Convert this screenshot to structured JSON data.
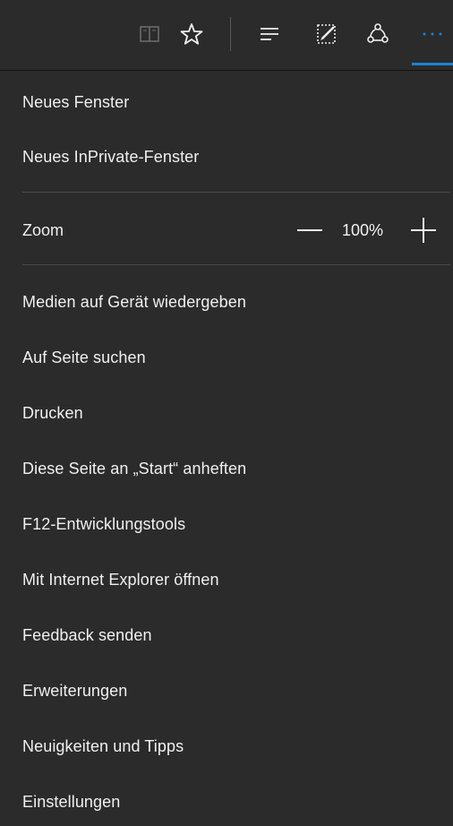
{
  "toolbar": {
    "buttons": [
      {
        "name": "reading-view-icon"
      },
      {
        "name": "favorites-star-icon"
      },
      {
        "name": "hub-icon"
      },
      {
        "name": "web-note-icon"
      },
      {
        "name": "share-icon"
      },
      {
        "name": "more-actions-icon"
      }
    ],
    "accent_color": "#1883d7"
  },
  "menu": {
    "new_window": "Neues Fenster",
    "new_inprivate_window": "Neues InPrivate-Fenster",
    "zoom": {
      "label": "Zoom",
      "value": "100%"
    },
    "cast_media": "Medien auf Gerät wiedergeben",
    "find_on_page": "Auf Seite suchen",
    "print": "Drucken",
    "pin_to_start": "Diese Seite an „Start“ anheften",
    "dev_tools": "F12-Entwicklungstools",
    "open_with_ie": "Mit Internet Explorer öffnen",
    "send_feedback": "Feedback senden",
    "extensions": "Erweiterungen",
    "whats_new": "Neuigkeiten und Tipps",
    "settings": "Einstellungen"
  }
}
